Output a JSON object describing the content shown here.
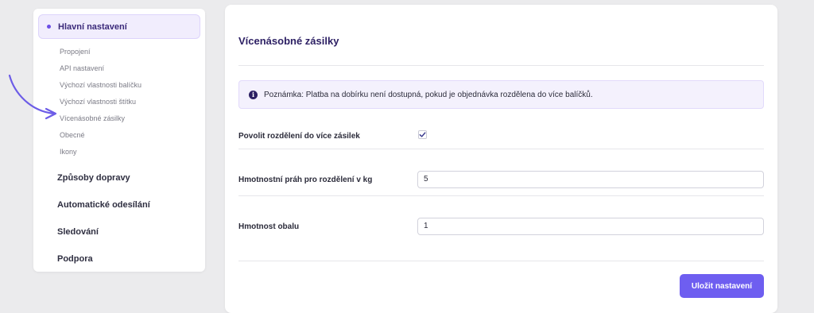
{
  "sidebar": {
    "active_section": "Hlavní nastavení",
    "sub_items": [
      {
        "label": "Propojení"
      },
      {
        "label": "API nastavení"
      },
      {
        "label": "Výchozí vlastnosti balíčku"
      },
      {
        "label": "Výchozí vlastnosti štítku"
      },
      {
        "label": "Vícenásobné zásilky"
      },
      {
        "label": "Obecné"
      },
      {
        "label": "Ikony"
      }
    ],
    "main_items": [
      {
        "label": "Způsoby dopravy"
      },
      {
        "label": "Automatické odesílání"
      },
      {
        "label": "Sledování"
      },
      {
        "label": "Podpora"
      }
    ]
  },
  "main": {
    "title": "Vícenásobné zásilky",
    "note": {
      "icon": "info-icon",
      "text": "Poznámka: Platba na dobírku není dostupná, pokud je objednávka rozdělena do více balíčků."
    },
    "fields": {
      "split_enabled": {
        "label": "Povolit rozdělení do více zásilek",
        "checked": true
      },
      "weight_threshold": {
        "label": "Hmotnostní práh pro rozdělení v kg",
        "value": "5"
      },
      "packaging_weight": {
        "label": "Hmotnost obalu",
        "value": "1"
      }
    },
    "save_label": "Uložit nastavení"
  },
  "colors": {
    "accent": "#6e5ef0",
    "active_bg": "#f1edfd",
    "title": "#2c1f63",
    "background": "#ebebed"
  }
}
